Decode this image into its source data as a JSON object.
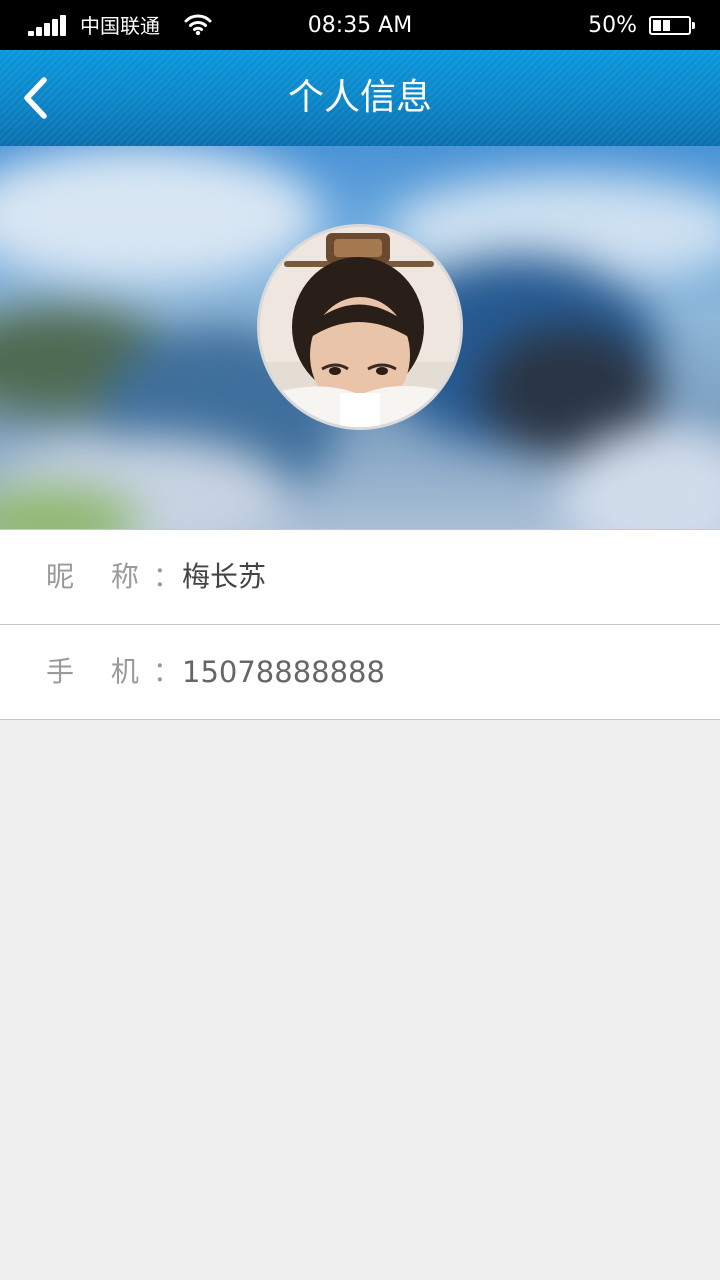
{
  "status_bar": {
    "carrier": "中国联通",
    "time": "08:35 AM",
    "battery_percent": "50%",
    "battery_level": 0.5,
    "signal_bars": 5,
    "icons": [
      "signal-icon",
      "wifi-icon",
      "battery-icon"
    ]
  },
  "nav": {
    "title": "个人信息",
    "back_icon": "chevron-left-icon"
  },
  "profile": {
    "avatar": "avatar-photo"
  },
  "info": {
    "rows": [
      {
        "label": "昵 称：",
        "value": "梅长苏"
      },
      {
        "label": "手 机：",
        "value": "15078888888"
      }
    ]
  },
  "colors": {
    "nav_bar": "#0b84c6",
    "status_bar": "#000000",
    "page_background": "#efefef",
    "label_text": "#9a9a9a",
    "value_text": "#444444"
  }
}
